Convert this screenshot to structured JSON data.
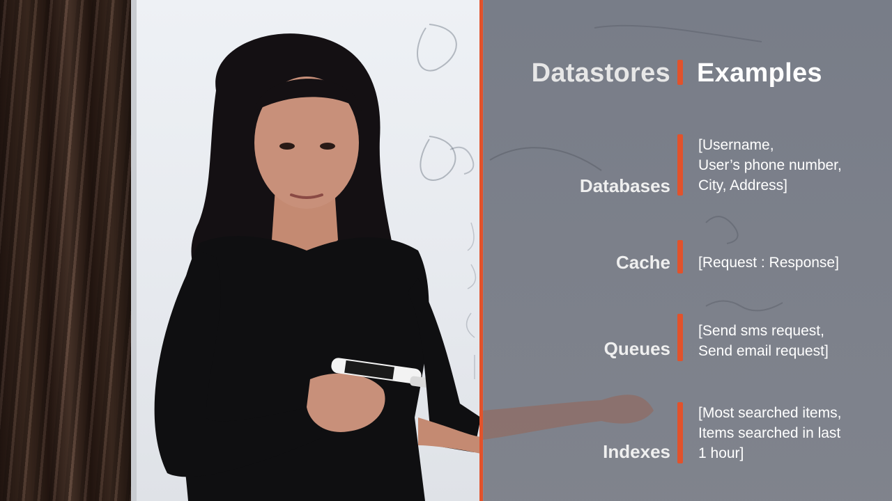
{
  "overlay": {
    "heading_left": "Datastores",
    "heading_right": "Examples",
    "rows": [
      {
        "label": "Databases",
        "example": "[Username,\nUser’s phone number,\nCity, Address]"
      },
      {
        "label": "Cache",
        "example": "[Request : Response]"
      },
      {
        "label": "Queues",
        "example": "[Send sms request,\nSend email request]"
      },
      {
        "label": "Indexes",
        "example": "[Most searched items,\nItems searched in last\n1 hour]"
      }
    ]
  },
  "colors": {
    "accent": "#e2522b",
    "overlay_bg": "#868a94"
  },
  "icons": [
    "whiteboard-marker"
  ]
}
